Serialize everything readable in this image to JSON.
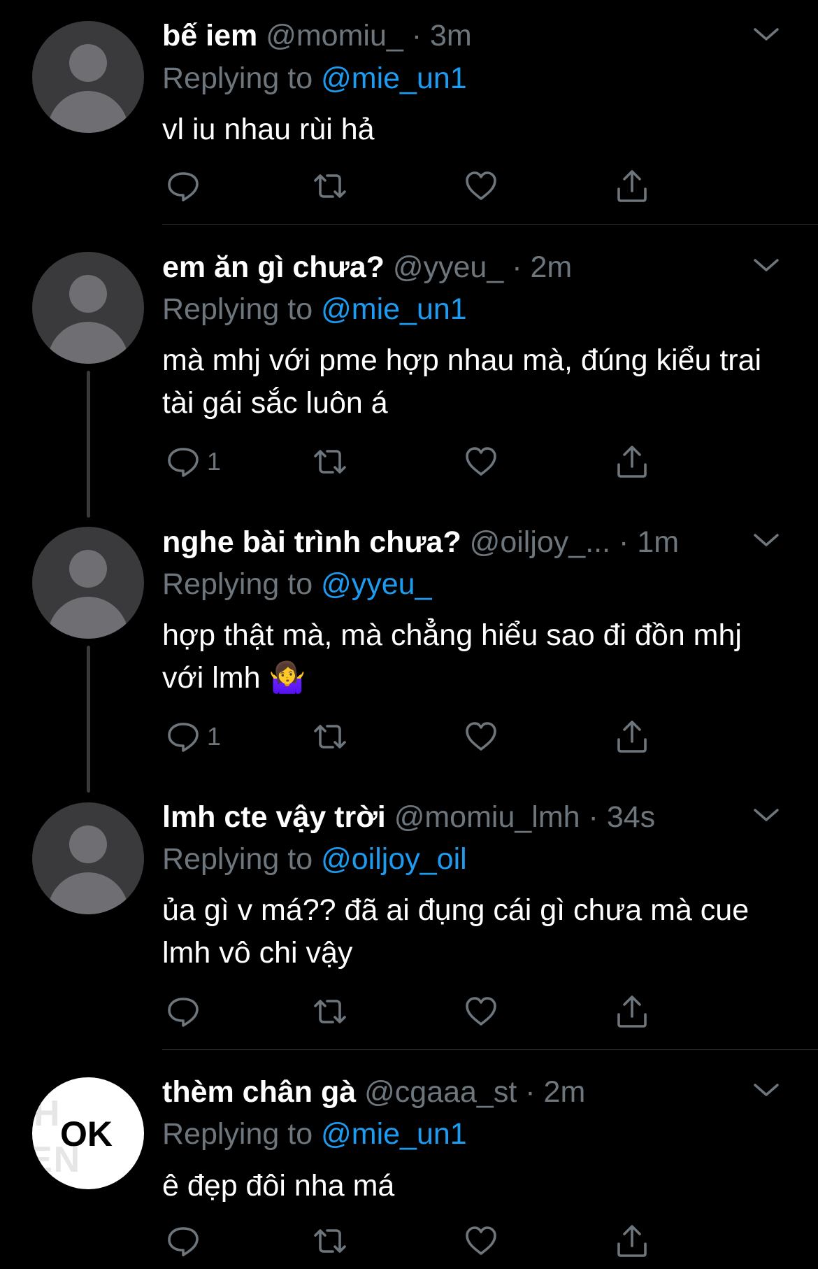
{
  "tweets": [
    {
      "name": "bế iem",
      "handle": "@momiu_",
      "dot": "·",
      "time": "3m",
      "reply_prefix": "Replying to",
      "reply_to": "@mie_un1",
      "text": "vl iu nhau rùi hả",
      "reply_count": "",
      "avatar": "default-avatar"
    },
    {
      "name": "em ăn gì chưa?",
      "handle": "@yyeu_",
      "dot": "·",
      "time": "2m",
      "reply_prefix": "Replying to",
      "reply_to": "@mie_un1",
      "text": "mà mhj với pme hợp nhau mà, đúng kiểu trai tài gái sắc luôn á",
      "reply_count": "1",
      "avatar": "default-avatar"
    },
    {
      "name": "nghe bài trình chưa?",
      "handle": "@oiljoy_...",
      "dot": "·",
      "time": "1m",
      "reply_prefix": "Replying to",
      "reply_to": "@yyeu_",
      "text": "hợp thật mà, mà chẳng hiểu sao đi đồn mhj với lmh 🤷‍♀️",
      "reply_count": "1",
      "avatar": "default-avatar"
    },
    {
      "name": "lmh cte vậy trời",
      "handle": "@momiu_lmh",
      "dot": "·",
      "time": "34s",
      "reply_prefix": "Replying to",
      "reply_to": "@oiljoy_oil",
      "text": "ủa gì v má?? đã ai đụng cái gì chưa mà cue lmh vô chi vậy",
      "reply_count": "",
      "avatar": "default-avatar"
    },
    {
      "name": "thèm chân gà",
      "handle": "@cgaaa_st",
      "dot": "·",
      "time": "2m",
      "reply_prefix": "Replying to",
      "reply_to": "@mie_un1",
      "text": "ê đẹp đôi nha má",
      "reply_count": "",
      "avatar": "ok-avatar",
      "avatar_text": "OK"
    }
  ],
  "icons": {
    "reply": "reply-icon",
    "retweet": "retweet-icon",
    "like": "heart-icon",
    "share": "share-icon",
    "more": "chevron-down-icon"
  },
  "colors": {
    "background": "#000000",
    "mention": "#1d9bf0",
    "secondary_text": "#6e767d"
  }
}
